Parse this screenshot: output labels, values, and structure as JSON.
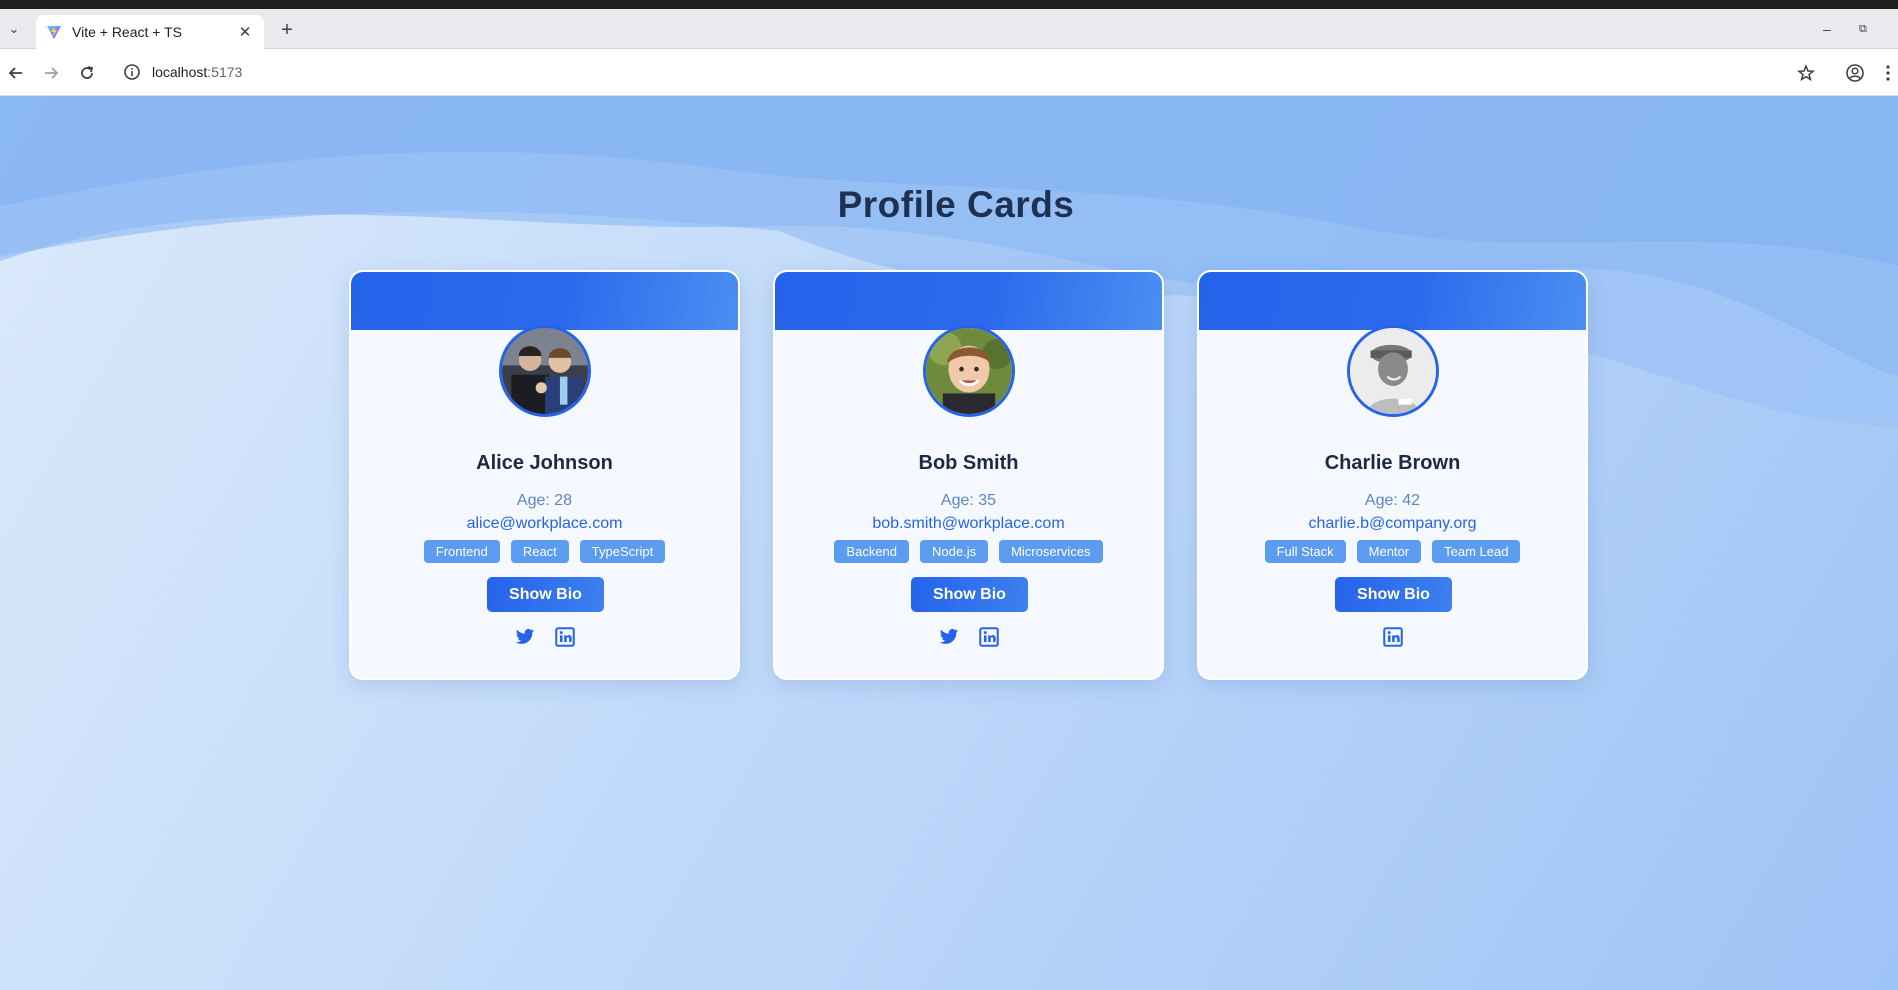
{
  "browser": {
    "tab_title": "Vite + React + TS",
    "url_host": "localhost",
    "url_port": ":5173"
  },
  "page": {
    "title": "Profile Cards"
  },
  "colors": {
    "accent": "#2563eb",
    "tag_bg": "#5b9bf0",
    "title_text": "#1e3152"
  },
  "cards": [
    {
      "name": "Alice Johnson",
      "age": "Age: 28",
      "email": "alice@workplace.com",
      "tags": [
        "Frontend",
        "React",
        "TypeScript"
      ],
      "button": "Show Bio",
      "socials": [
        "twitter-icon",
        "linkedin-icon"
      ]
    },
    {
      "name": "Bob Smith",
      "age": "Age: 35",
      "email": "bob.smith@workplace.com",
      "tags": [
        "Backend",
        "Node.js",
        "Microservices"
      ],
      "button": "Show Bio",
      "socials": [
        "twitter-icon",
        "linkedin-icon"
      ]
    },
    {
      "name": "Charlie Brown",
      "age": "Age: 42",
      "email": "charlie.b@company.org",
      "tags": [
        "Full Stack",
        "Mentor",
        "Team Lead"
      ],
      "button": "Show Bio",
      "socials": [
        "linkedin-icon"
      ]
    }
  ]
}
